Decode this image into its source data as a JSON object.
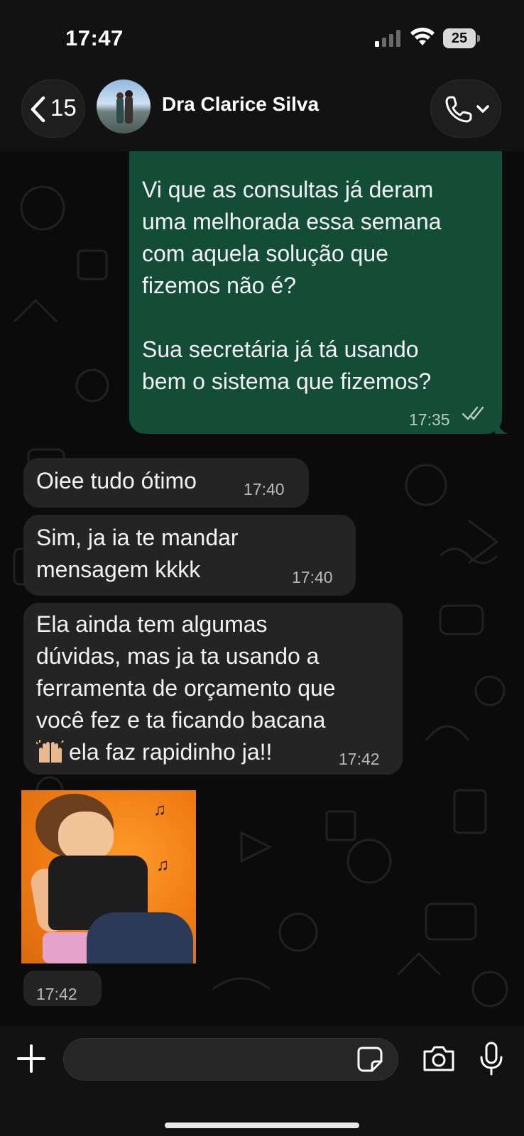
{
  "status_bar": {
    "time": "17:47",
    "battery": "25"
  },
  "header": {
    "back_count": "15",
    "contact_name": "Dra Clarice Silva"
  },
  "messages": [
    {
      "direction": "outgoing",
      "text": "Vi que as consultas já deram\numa melhorada essa semana\ncom aquela solução que\nfizemos  não é?\n\nSua secretária já tá usando\nbem o sistema que fizemos?",
      "time": "17:35",
      "status": "read"
    },
    {
      "direction": "incoming",
      "text": "Oiee tudo ótimo",
      "time": "17:40"
    },
    {
      "direction": "incoming",
      "text": "Sim, ja ia te mandar\nmensagem kkkk",
      "time": "17:40"
    },
    {
      "direction": "incoming",
      "text_lines": "Ela ainda tem algumas\ndúvidas, mas ja ta usando a\nferramenta de orçamento que\nvocê fez e ta ficando bacana",
      "text_last": "ela faz rapidinho ja!!",
      "emoji": "raising-hands-emoji",
      "time": "17:42"
    },
    {
      "direction": "incoming",
      "type": "sticker",
      "time": "17:42"
    }
  ],
  "colors": {
    "outgoing_bubble": "#144d37",
    "incoming_bubble": "#242424",
    "background": "#0b0b0b",
    "sticker_background": "#f07f1a"
  },
  "input": {
    "placeholder": "",
    "value": ""
  },
  "icons": [
    "chevron-left-icon",
    "phone-icon",
    "chevron-down-icon",
    "double-check-icon",
    "plus-icon",
    "sticker-icon",
    "camera-icon",
    "microphone-icon",
    "signal-icon",
    "wifi-icon",
    "battery-icon"
  ]
}
